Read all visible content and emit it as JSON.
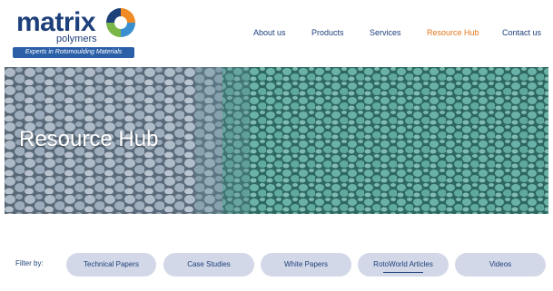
{
  "brand": {
    "name": "matrix",
    "subtitle": "polymers",
    "tagline": "Experts in Rotomoulding Materials",
    "colors": {
      "navy": "#1d3f7a",
      "accent": "#e2761b",
      "strip": "#2b5fa8"
    }
  },
  "nav": {
    "items": [
      {
        "label": "About us",
        "active": false
      },
      {
        "label": "Products",
        "active": false
      },
      {
        "label": "Services",
        "active": false
      },
      {
        "label": "Resource Hub",
        "active": true
      },
      {
        "label": "Contact us",
        "active": false
      }
    ]
  },
  "hero": {
    "title": "Resource Hub"
  },
  "filters": {
    "label": "Filter by:",
    "options": [
      {
        "label": "Technical Papers",
        "selected": false
      },
      {
        "label": "Case Studies",
        "selected": false
      },
      {
        "label": "White Papers",
        "selected": false
      },
      {
        "label": "RotoWorld Articles",
        "selected": true
      },
      {
        "label": "Videos",
        "selected": false
      }
    ],
    "pill_color": "#d3d8e8"
  }
}
